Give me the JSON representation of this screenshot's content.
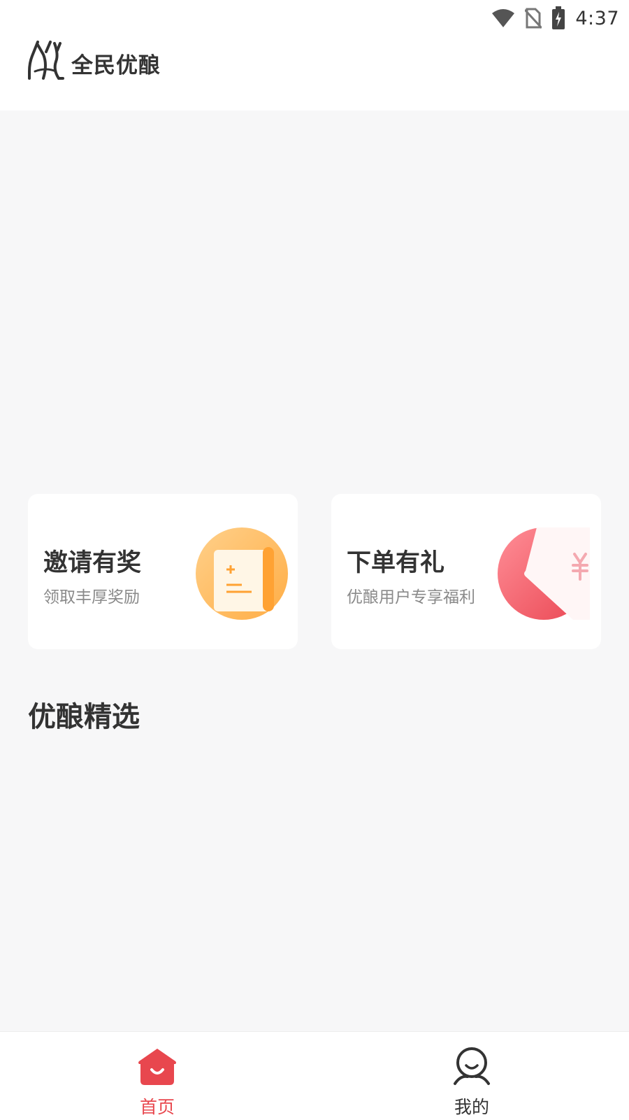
{
  "status_bar": {
    "time": "4:37",
    "icons": [
      "wifi-icon",
      "no-sim-icon",
      "battery-charging-icon"
    ]
  },
  "header": {
    "title": "全民优酿",
    "logo_icon": "brand-logo-icon"
  },
  "cards": [
    {
      "title": "邀请有奖",
      "subtitle": "领取丰厚奖励",
      "icon": "invite-scroll-icon",
      "accent": "#ffb24d"
    },
    {
      "title": "下单有礼",
      "subtitle": "优酿用户专享福利",
      "icon": "yen-coupon-icon",
      "accent": "#f0555f"
    }
  ],
  "section": {
    "title": "优酿精选"
  },
  "tabs": [
    {
      "label": "首页",
      "icon": "home-icon",
      "active": true,
      "color": "#e8474e"
    },
    {
      "label": "我的",
      "icon": "profile-icon",
      "active": false,
      "color": "#333333"
    }
  ],
  "colors": {
    "accent": "#e8474e",
    "background": "#f7f7f8"
  }
}
